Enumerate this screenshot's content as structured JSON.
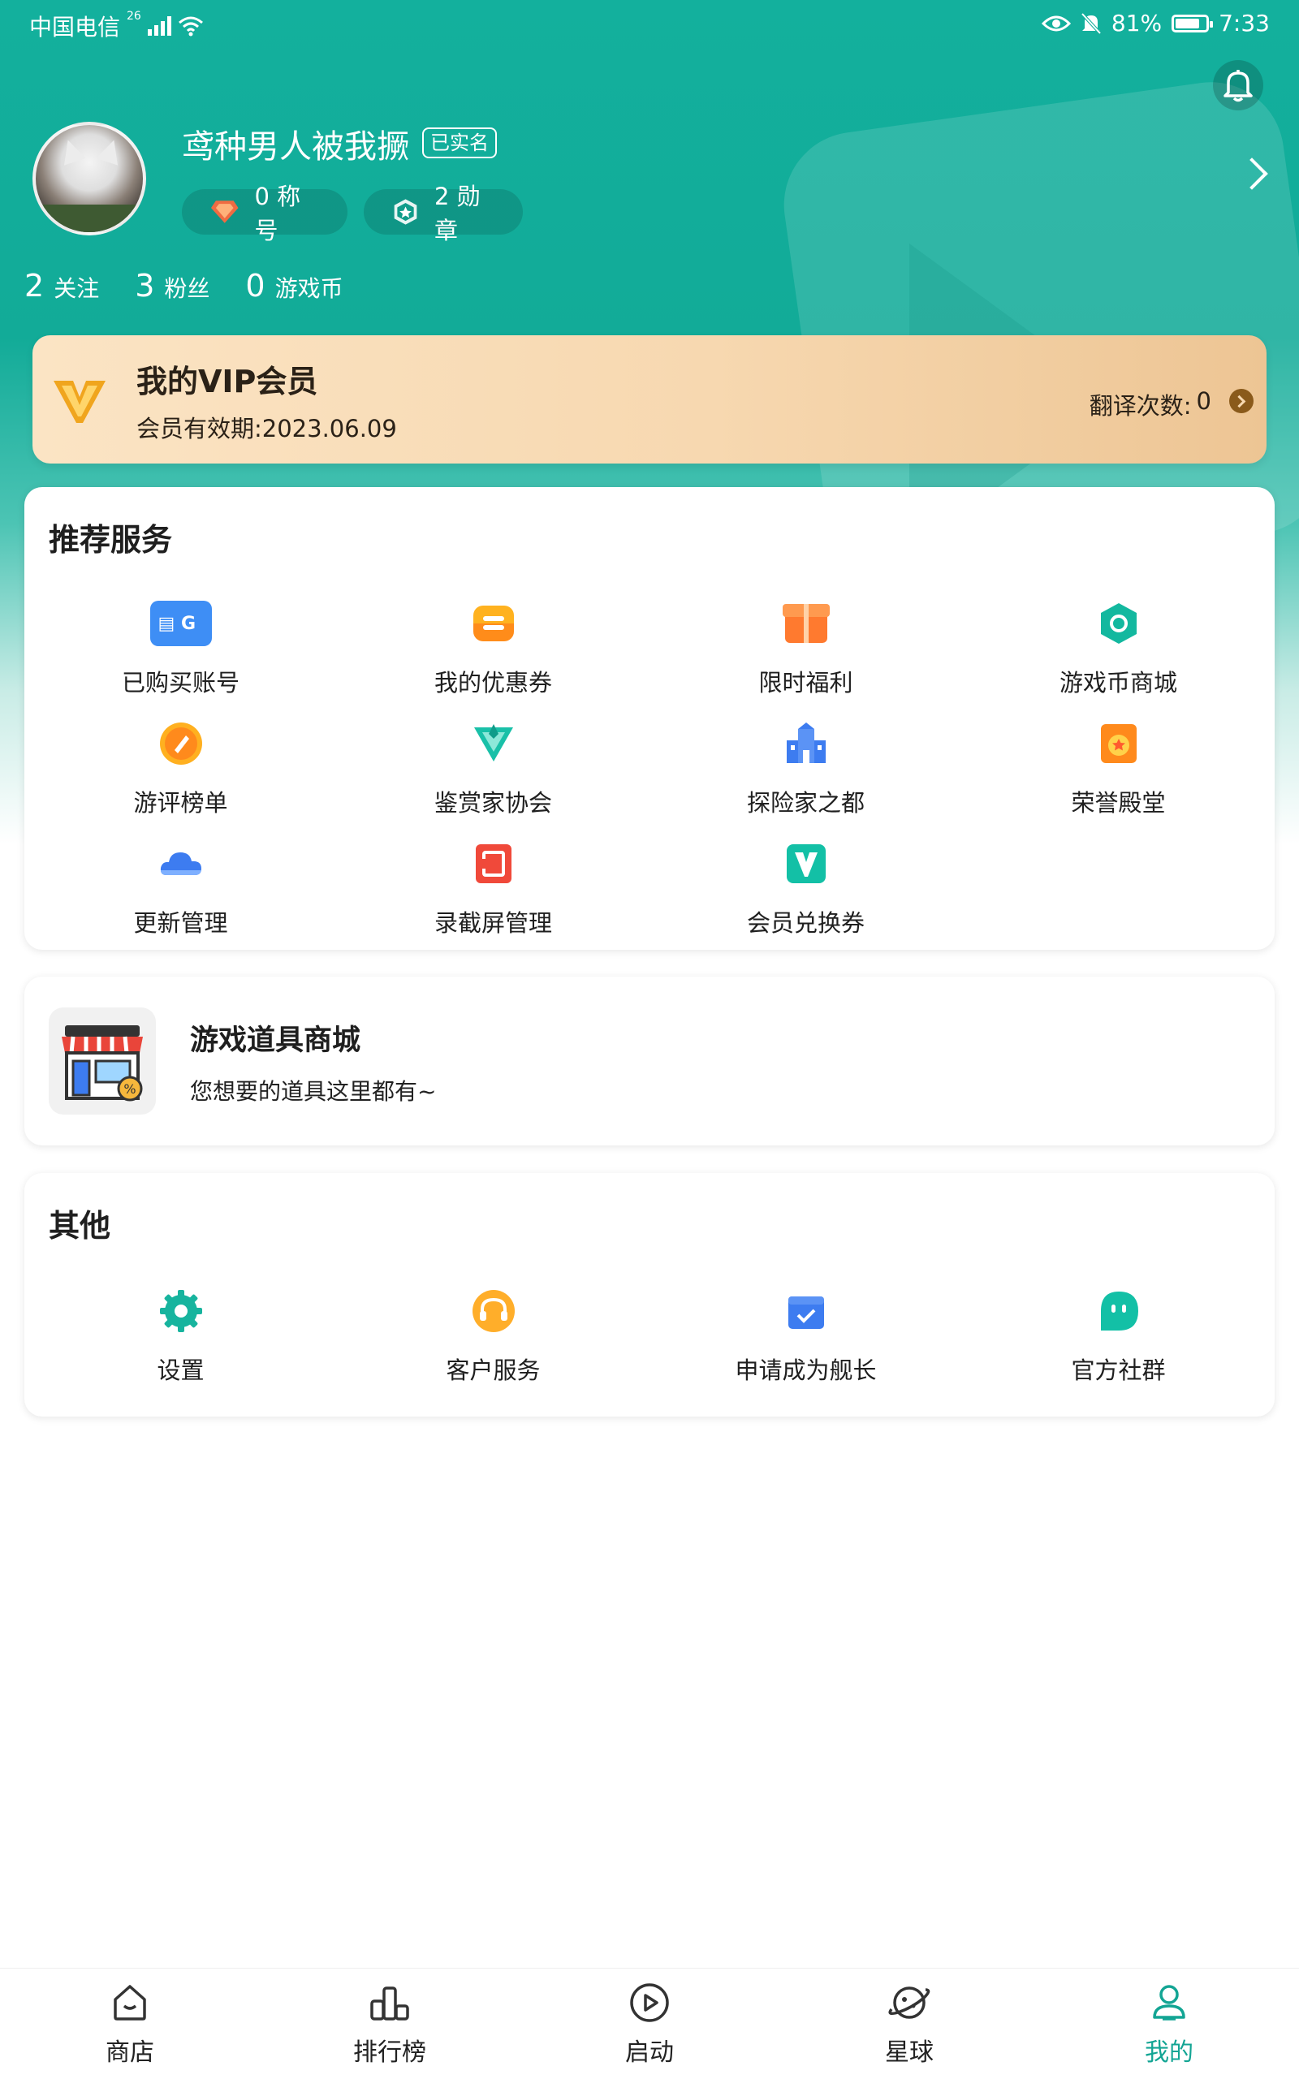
{
  "status_bar": {
    "carrier": "中国电信",
    "network": "26",
    "battery": "81%",
    "time": "7:33",
    "battery_level": 0.81
  },
  "profile": {
    "username": "鸢种男人被我撅",
    "verified_badge": "已实名",
    "title_pill": "0 称号",
    "medal_pill": "2 勋章",
    "stats": [
      {
        "num": "2",
        "label": "关注"
      },
      {
        "num": "3",
        "label": "粉丝"
      },
      {
        "num": "0",
        "label": "游戏币"
      }
    ]
  },
  "vip": {
    "title": "我的VIP会员",
    "expiry": "会员有效期:2023.06.09",
    "translate_label": "翻译次数:",
    "translate_count": "0"
  },
  "recommended": {
    "title": "推荐服务",
    "items": [
      {
        "label": "已购买账号",
        "icon": "purchased-account-icon"
      },
      {
        "label": "我的优惠券",
        "icon": "coupon-icon"
      },
      {
        "label": "限时福利",
        "icon": "gift-icon"
      },
      {
        "label": "游戏币商城",
        "icon": "coin-mall-icon"
      },
      {
        "label": "游评榜单",
        "icon": "review-rank-icon"
      },
      {
        "label": "鉴赏家协会",
        "icon": "connoisseur-icon"
      },
      {
        "label": "探险家之都",
        "icon": "castle-icon"
      },
      {
        "label": "荣誉殿堂",
        "icon": "honor-hall-icon"
      },
      {
        "label": "更新管理",
        "icon": "cloud-icon"
      },
      {
        "label": "录截屏管理",
        "icon": "screen-record-icon"
      },
      {
        "label": "会员兑换券",
        "icon": "vip-voucher-icon"
      }
    ]
  },
  "shop": {
    "title": "游戏道具商城",
    "desc": "您想要的道具这里都有~"
  },
  "other": {
    "title": "其他",
    "items": [
      {
        "label": "设置",
        "icon": "gear-icon"
      },
      {
        "label": "客户服务",
        "icon": "headset-icon"
      },
      {
        "label": "申请成为舰长",
        "icon": "apply-captain-icon"
      },
      {
        "label": "官方社群",
        "icon": "community-icon"
      }
    ]
  },
  "nav": [
    {
      "label": "商店",
      "icon": "store-icon"
    },
    {
      "label": "排行榜",
      "icon": "ranking-icon"
    },
    {
      "label": "启动",
      "icon": "play-icon"
    },
    {
      "label": "星球",
      "icon": "planet-icon"
    },
    {
      "label": "我的",
      "icon": "profile-icon",
      "active": true
    }
  ],
  "colors": {
    "brand": "#13b09d",
    "nav_active": "#13a594",
    "vip_gold": "#edc594"
  }
}
